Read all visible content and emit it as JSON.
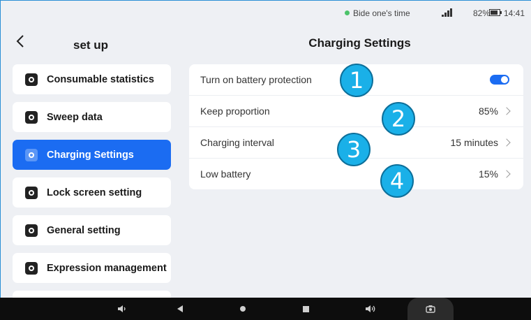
{
  "status_bar": {
    "status_text": "Bide one's time",
    "battery_percent": "82%",
    "battery_level": 0.82,
    "time": "14:41",
    "dot_color": "#4cc36a"
  },
  "header": {
    "back_icon": "chevron-left-icon",
    "sidebar_title": "set up",
    "page_title": "Charging Settings"
  },
  "sidebar": {
    "items": [
      {
        "label": "Consumable statistics",
        "icon": "gear-icon",
        "active": false
      },
      {
        "label": "Sweep data",
        "icon": "gear-icon",
        "active": false
      },
      {
        "label": "Charging Settings",
        "icon": "gear-icon",
        "active": true
      },
      {
        "label": "Lock screen setting",
        "icon": "gear-icon",
        "active": false
      },
      {
        "label": "General setting",
        "icon": "gear-icon",
        "active": false
      },
      {
        "label": "Expression management",
        "icon": "gear-icon",
        "active": false
      }
    ]
  },
  "settings": {
    "battery_protection": {
      "label": "Turn on battery protection",
      "enabled": true
    },
    "keep_proportion": {
      "label": "Keep proportion",
      "value": "85%"
    },
    "charging_interval": {
      "label": "Charging interval",
      "value": "15 minutes"
    },
    "low_battery": {
      "label": "Low battery",
      "value": "15%"
    }
  },
  "annotations": [
    "1",
    "2",
    "3",
    "4"
  ],
  "colors": {
    "accent": "#1b6cf2",
    "badge": "#1ab0e8",
    "background": "#eef0f4"
  }
}
